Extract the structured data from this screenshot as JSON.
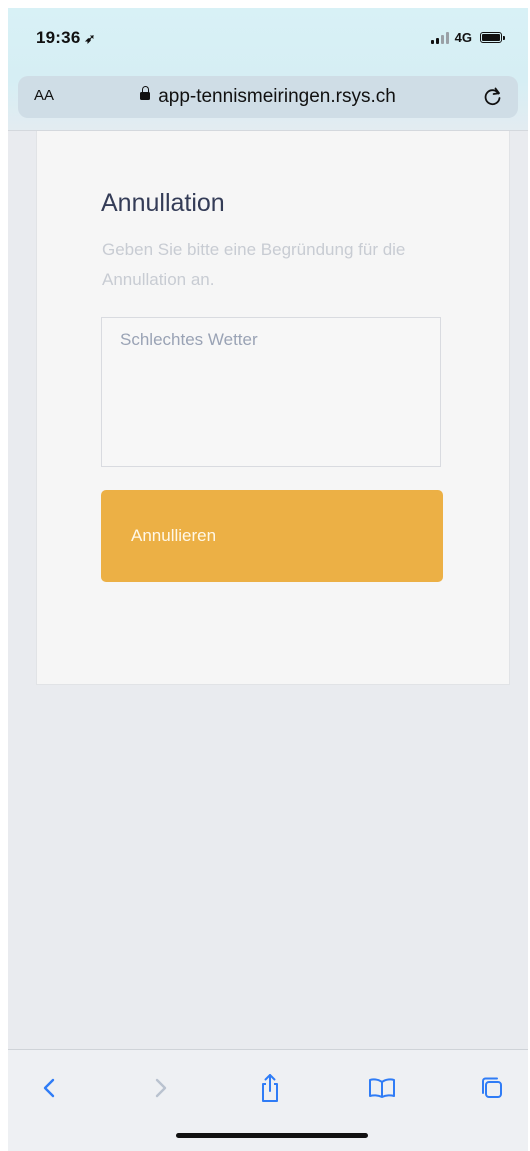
{
  "status_bar": {
    "time": "19:36",
    "network": "4G"
  },
  "address_bar": {
    "text_size_label": "AA",
    "url": "app-tennismeiringen.rsys.ch"
  },
  "card": {
    "title": "Annullation",
    "description": "Geben Sie bitte eine Begründung für die Annullation an.",
    "reason_value": "Schlechtes Wetter",
    "cancel_button_label": "Annullieren"
  },
  "colors": {
    "accent_button": "#ecb045",
    "title_text": "#343c57"
  },
  "toolbar": {
    "icons": [
      "back-icon",
      "forward-icon",
      "share-icon",
      "bookmarks-icon",
      "tabs-icon"
    ]
  }
}
